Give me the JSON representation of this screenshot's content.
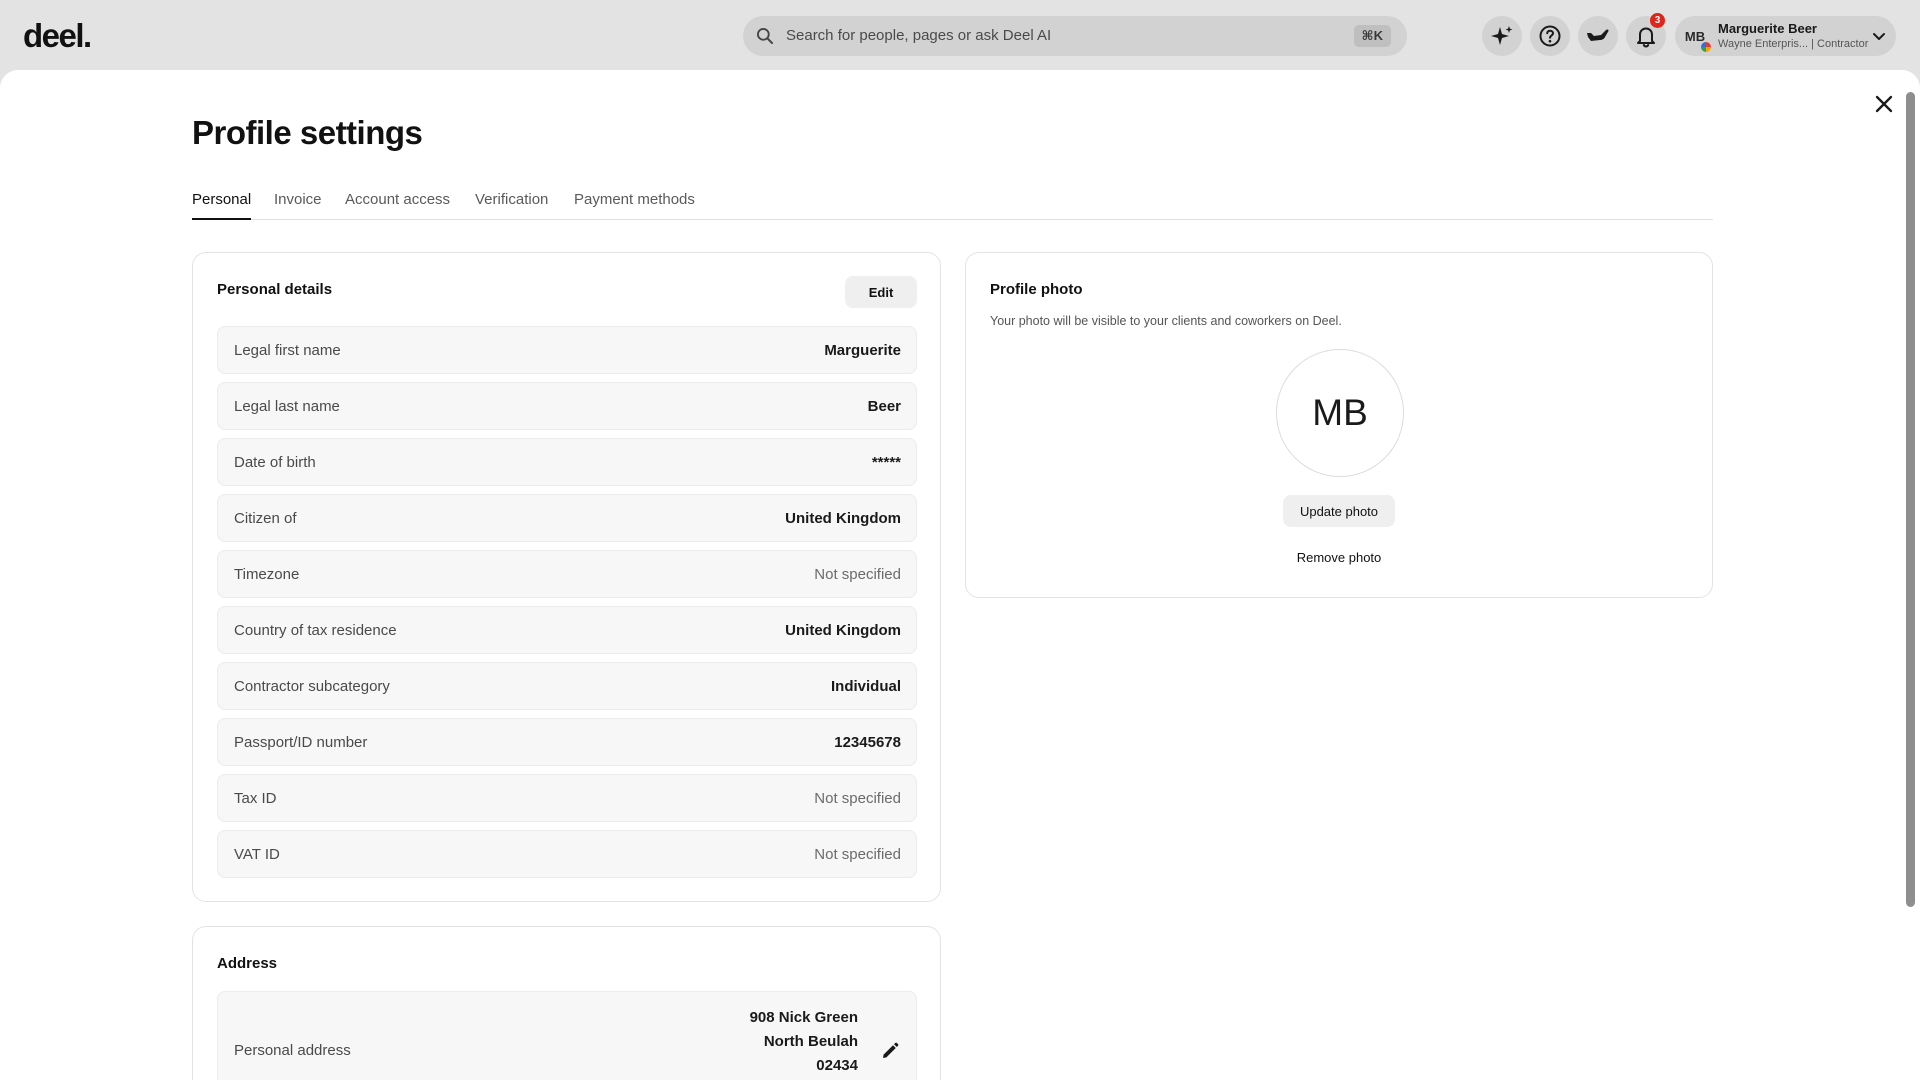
{
  "brand": {
    "logo_text": "deel."
  },
  "search": {
    "placeholder": "Search for people, pages or ask Deel AI",
    "shortcut": "⌘K"
  },
  "header": {
    "notifications_count": "3",
    "user": {
      "initials": "MB",
      "name": "Marguerite Beer",
      "subtitle": "Wayne Enterpris... | Contractor"
    }
  },
  "page": {
    "title": "Profile settings"
  },
  "tabs": [
    {
      "label": "Personal",
      "active": true
    },
    {
      "label": "Invoice",
      "active": false
    },
    {
      "label": "Account access",
      "active": false
    },
    {
      "label": "Verification",
      "active": false
    },
    {
      "label": "Payment methods",
      "active": false
    }
  ],
  "personal_details": {
    "title": "Personal details",
    "edit_label": "Edit",
    "fields": [
      {
        "label": "Legal first name",
        "value": "Marguerite",
        "muted": false
      },
      {
        "label": "Legal last name",
        "value": "Beer",
        "muted": false
      },
      {
        "label": "Date of birth",
        "value": "*****",
        "muted": false
      },
      {
        "label": "Citizen of",
        "value": "United Kingdom",
        "muted": false
      },
      {
        "label": "Timezone",
        "value": "Not specified",
        "muted": true
      },
      {
        "label": "Country of tax residence",
        "value": "United Kingdom",
        "muted": false
      },
      {
        "label": "Contractor subcategory",
        "value": "Individual",
        "muted": false
      },
      {
        "label": "Passport/ID number",
        "value": "12345678",
        "muted": false
      },
      {
        "label": "Tax ID",
        "value": "Not specified",
        "muted": true
      },
      {
        "label": "VAT ID",
        "value": "Not specified",
        "muted": true
      }
    ]
  },
  "profile_photo": {
    "title": "Profile photo",
    "description": "Your photo will be visible to your clients and coworkers on Deel.",
    "initials": "MB",
    "update_label": "Update photo",
    "remove_label": "Remove photo"
  },
  "address": {
    "title": "Address",
    "label": "Personal address",
    "lines": [
      "908 Nick Green",
      "North Beulah",
      "02434"
    ]
  },
  "colors": {
    "badge": "#e0261b",
    "topbar_bg": "#e3e3e3",
    "sheet_bg": "#ffffff"
  }
}
